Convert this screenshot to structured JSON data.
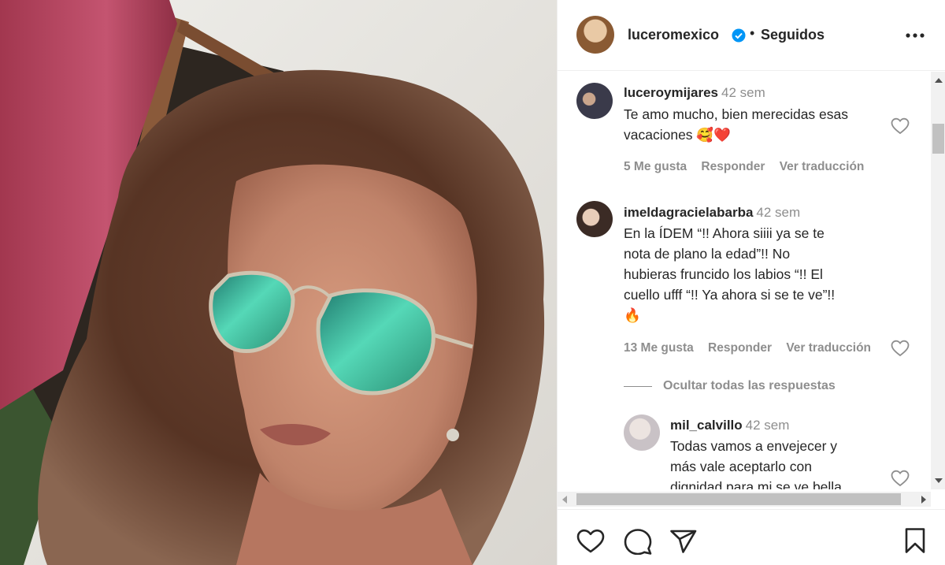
{
  "post": {
    "username": "luceromexico",
    "separator": "•",
    "follow_status": "Seguidos"
  },
  "comments": [
    {
      "username": "luceroymijares",
      "time": "42 sem",
      "text_line1": "Te amo mucho, bien merecidas esas",
      "text_line2": "vacaciones 🥰❤️",
      "likes": "5 Me gusta",
      "reply": "Responder",
      "translate": "Ver traducción"
    },
    {
      "username": "imeldagracielabarba",
      "time": "42 sem",
      "text_line1": "En la ÍDEM “!! Ahora siiii ya se te",
      "text_line2": "nota de plano la edad”!! No",
      "text_line3": "hubieras fruncido los labios “!! El",
      "text_line4": "cuello ufff “!! Ya ahora si se te ve”!!",
      "text_line5": "🔥",
      "likes": "13 Me gusta",
      "reply": "Responder",
      "translate": "Ver traducción"
    }
  ],
  "hide_replies_label": "Ocultar todas las respuestas",
  "reply": {
    "username": "mil_calvillo",
    "time": "42 sem",
    "text_line1": "Todas vamos a envejecer y",
    "text_line2": "más vale aceptarlo con",
    "text_line3": "dignidad para mi se ve bella"
  },
  "icons": {
    "verified": "verified-badge-icon",
    "more": "more-options-icon",
    "like": "heart-icon",
    "comment": "comment-icon",
    "share": "send-icon",
    "save": "bookmark-icon"
  },
  "colors": {
    "verified_blue": "#0095f6",
    "heart_red": "#ed4956",
    "muted_text": "#8e8e8e"
  }
}
